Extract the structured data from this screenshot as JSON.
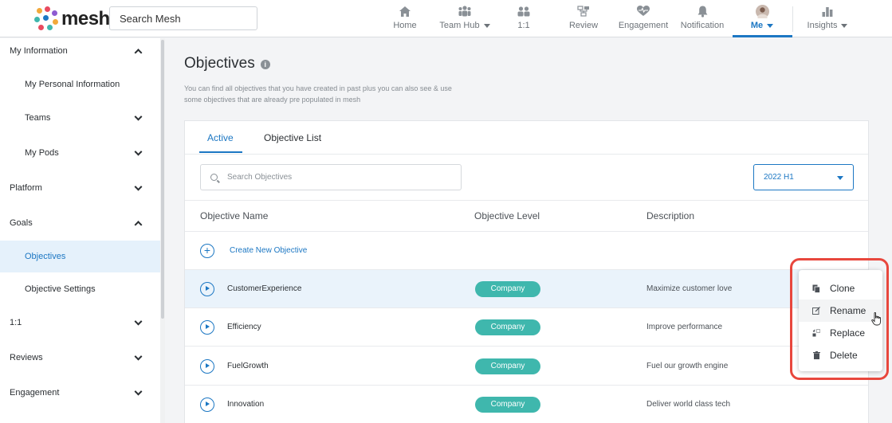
{
  "header": {
    "logo_text": "mesh",
    "search_placeholder": "Search Mesh",
    "nav": [
      {
        "label": "Home",
        "icon": "home-icon"
      },
      {
        "label": "Team Hub",
        "icon": "team-icon",
        "dropdown": true
      },
      {
        "label": "1:1",
        "icon": "one-on-one-icon"
      },
      {
        "label": "Review",
        "icon": "review-icon"
      },
      {
        "label": "Engagement",
        "icon": "heart-pulse-icon"
      },
      {
        "label": "Notification",
        "icon": "bell-icon"
      },
      {
        "label": "Me",
        "icon": "avatar",
        "active": true,
        "dropdown": true
      },
      {
        "label": "Insights",
        "icon": "bar-chart-icon",
        "dropdown": true
      }
    ],
    "accent": "#1c77c3"
  },
  "sidebar": {
    "items": [
      {
        "label": "My Information",
        "level": 0,
        "chevron": "up"
      },
      {
        "label": "My Personal Information",
        "level": 1
      },
      {
        "label": "Teams",
        "level": 1,
        "chevron": "down"
      },
      {
        "label": "My Pods",
        "level": 1,
        "chevron": "down"
      },
      {
        "label": "Platform",
        "level": 0,
        "chevron": "down"
      },
      {
        "label": "Goals",
        "level": 0,
        "chevron": "up"
      },
      {
        "label": "Objectives",
        "level": 1,
        "active": true
      },
      {
        "label": "Objective Settings",
        "level": 1
      },
      {
        "label": "1:1",
        "level": 0,
        "chevron": "down"
      },
      {
        "label": "Reviews",
        "level": 0,
        "chevron": "down"
      },
      {
        "label": "Engagement",
        "level": 0,
        "chevron": "down"
      }
    ]
  },
  "main": {
    "title": "Objectives",
    "description": "You can find all objectives that you have created in past plus you can also see & use some objectives that are already pre populated in mesh",
    "tabs": [
      {
        "label": "Active",
        "active": true
      },
      {
        "label": "Objective List"
      }
    ],
    "search_placeholder": "Search Objectives",
    "period": "2022 H1",
    "columns": [
      "Objective Name",
      "Objective Level",
      "Description"
    ],
    "create_label": "Create New Objective",
    "rows": [
      {
        "name": "CustomerExperience",
        "level": "Company",
        "description": "Maximize customer love",
        "highlighted": true
      },
      {
        "name": "Efficiency",
        "level": "Company",
        "description": "Improve performance"
      },
      {
        "name": "FuelGrowth",
        "level": "Company",
        "description": "Fuel our growth engine"
      },
      {
        "name": "Innovation",
        "level": "Company",
        "description": "Deliver world class tech"
      }
    ],
    "badge_color": "#3fb7ad"
  },
  "context_menu": {
    "items": [
      {
        "label": "Clone",
        "icon": "copy-icon"
      },
      {
        "label": "Rename",
        "icon": "edit-icon",
        "hover": true
      },
      {
        "label": "Replace",
        "icon": "replace-icon"
      },
      {
        "label": "Delete",
        "icon": "trash-icon"
      }
    ],
    "highlight_color": "#e8473d"
  }
}
